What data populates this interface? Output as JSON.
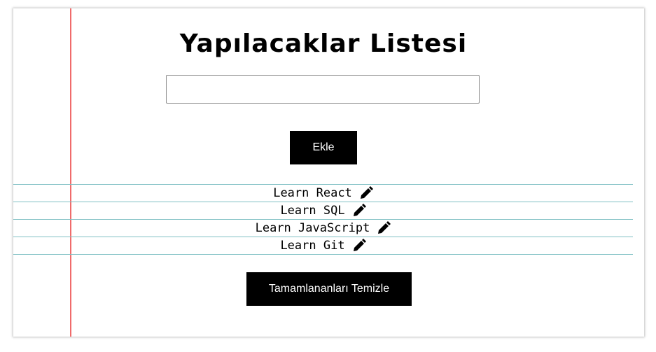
{
  "title": "Yapılacaklar Listesi",
  "input": {
    "value": "",
    "placeholder": ""
  },
  "add_button": {
    "label": "Ekle"
  },
  "todos": [
    {
      "text": "Learn React",
      "icon": "pencil-icon"
    },
    {
      "text": "Learn SQL",
      "icon": "pencil-icon"
    },
    {
      "text": "Learn JavaScript",
      "icon": "pencil-icon"
    },
    {
      "text": "Learn Git",
      "icon": "pencil-icon"
    }
  ],
  "clear_button": {
    "label": "Tamamlananları Temizle"
  },
  "colors": {
    "margin_line": "#f06b6b",
    "rule_line": "#7fc0c4",
    "button_bg": "#000000",
    "button_text": "#ffffff"
  }
}
